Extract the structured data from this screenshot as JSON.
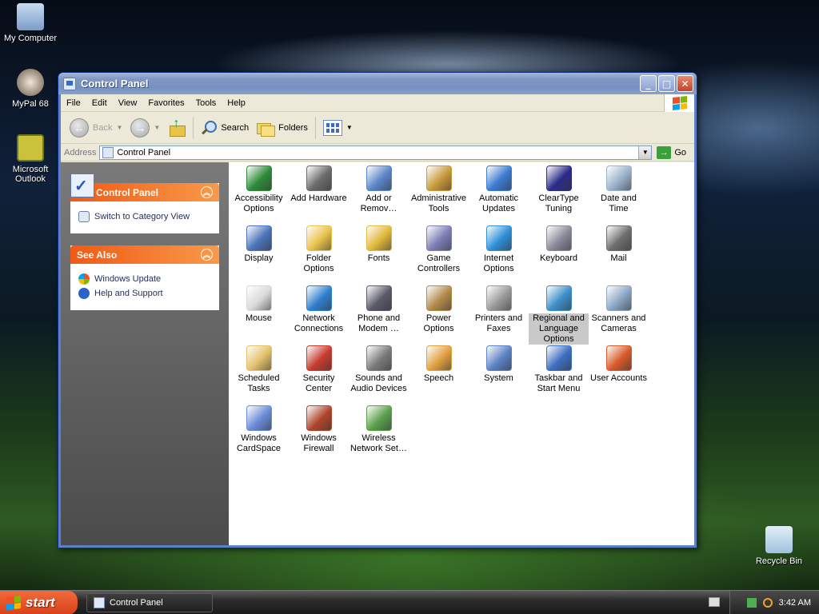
{
  "desktop": {
    "icons": [
      {
        "label": "My Computer"
      },
      {
        "label": "MyPal 68"
      },
      {
        "label": "Microsoft Outlook"
      },
      {
        "label": "Recycle Bin"
      }
    ]
  },
  "window": {
    "title": "Control Panel",
    "menu": [
      "File",
      "Edit",
      "View",
      "Favorites",
      "Tools",
      "Help"
    ],
    "toolbar": {
      "back_label": "Back",
      "search_label": "Search",
      "folders_label": "Folders"
    },
    "address": {
      "label": "Address",
      "value": "Control Panel",
      "go_label": "Go"
    },
    "taskpane": {
      "control_panel": {
        "title": "Control Panel",
        "link": "Switch to Category View"
      },
      "see_also": {
        "title": "See Also",
        "links": [
          "Windows Update",
          "Help and Support"
        ]
      }
    },
    "items": [
      {
        "label": "Accessibility Options",
        "color": "#2e8b3a"
      },
      {
        "label": "Add Hardware",
        "color": "#6b6b6b"
      },
      {
        "label": "Add or Remov…",
        "color": "#5a86c8"
      },
      {
        "label": "Administrative Tools",
        "color": "#c99a3b"
      },
      {
        "label": "Automatic Updates",
        "color": "#3b7bd0"
      },
      {
        "label": "ClearType Tuning",
        "color": "#2b2b8a"
      },
      {
        "label": "Date and Time",
        "color": "#9ab2cc"
      },
      {
        "label": "Display",
        "color": "#4a73b8"
      },
      {
        "label": "Folder Options",
        "color": "#e9c24a"
      },
      {
        "label": "Fonts",
        "color": "#e0b83c"
      },
      {
        "label": "Game Controllers",
        "color": "#7c7fb6"
      },
      {
        "label": "Internet Options",
        "color": "#2f8fd6"
      },
      {
        "label": "Keyboard",
        "color": "#8a8a9a"
      },
      {
        "label": "Mail",
        "color": "#6d6d6d"
      },
      {
        "label": "Mouse",
        "color": "#d9d9d9"
      },
      {
        "label": "Network Connections",
        "color": "#2f7fcf"
      },
      {
        "label": "Phone and Modem …",
        "color": "#5a5a6a"
      },
      {
        "label": "Power Options",
        "color": "#b38a4a"
      },
      {
        "label": "Printers and Faxes",
        "color": "#9a9a9a"
      },
      {
        "label": "Regional and Language Options",
        "color": "#3d8fc9"
      },
      {
        "label": "Scanners and Cameras",
        "color": "#8aa6c4"
      },
      {
        "label": "Scheduled Tasks",
        "color": "#e3c16a"
      },
      {
        "label": "Security Center",
        "color": "#c73c2f"
      },
      {
        "label": "Sounds and Audio Devices",
        "color": "#7b7b7b"
      },
      {
        "label": "Speech",
        "color": "#e0a040"
      },
      {
        "label": "System",
        "color": "#5b82c4"
      },
      {
        "label": "Taskbar and Start Menu",
        "color": "#3d6fc0"
      },
      {
        "label": "User Accounts",
        "color": "#d65a2a"
      },
      {
        "label": "Windows CardSpace",
        "color": "#6a8bd6"
      },
      {
        "label": "Windows Firewall",
        "color": "#b0452d"
      },
      {
        "label": "Wireless Network Set…",
        "color": "#5aa04a"
      }
    ],
    "selected_item_index": 19
  },
  "taskbar": {
    "start_label": "start",
    "task_button_label": "Control Panel",
    "clock": "3:42 AM"
  }
}
